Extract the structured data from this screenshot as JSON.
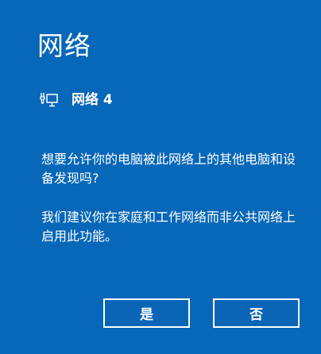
{
  "pane": {
    "title": "网络"
  },
  "network": {
    "icon": "ethernet-icon",
    "name": "网络 4"
  },
  "message": {
    "question": "想要允许你的电脑被此网络上的其他电脑和设备发现吗?",
    "recommendation": "我们建议你在家庭和工作网络而非公共网络上启用此功能。"
  },
  "buttons": {
    "yes_label": "是",
    "no_label": "否"
  },
  "colors": {
    "background": "#0767b8",
    "text": "#ffffff",
    "button_border": "#ffffff"
  }
}
